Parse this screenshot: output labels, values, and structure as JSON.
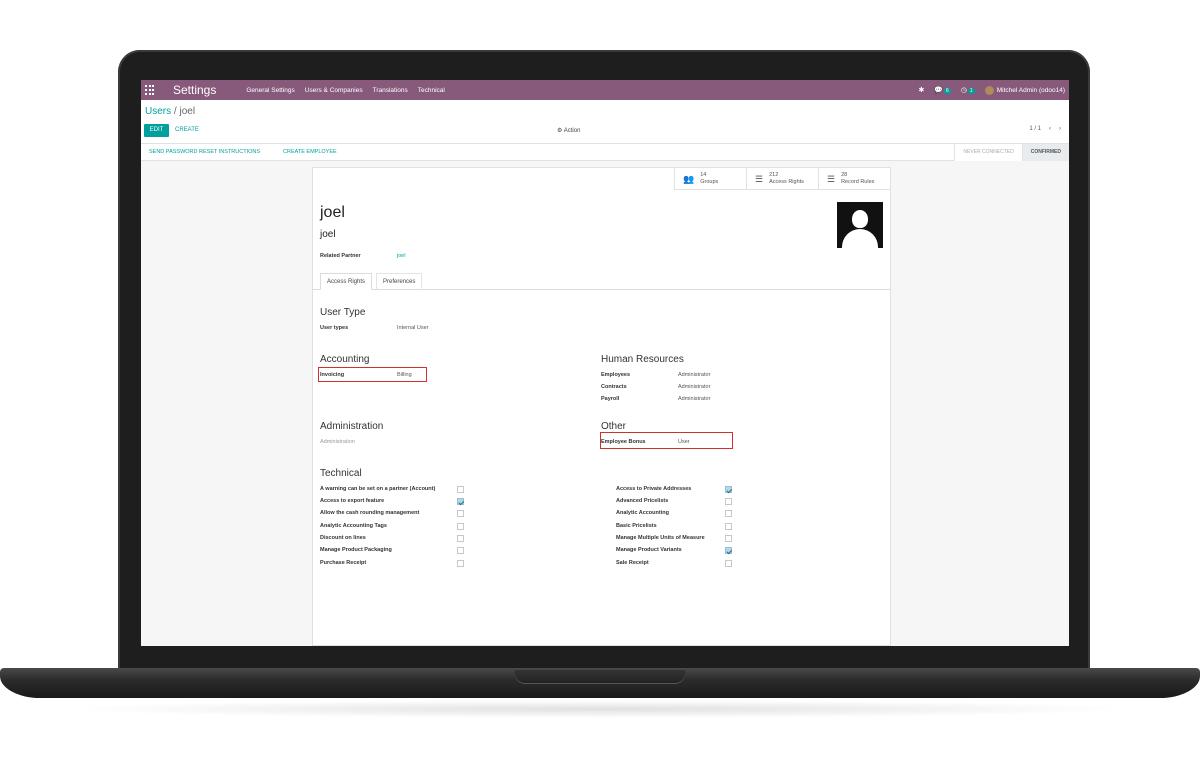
{
  "navbar": {
    "app_title": "Settings",
    "menu": [
      "General Settings",
      "Users & Companies",
      "Translations",
      "Technical"
    ],
    "messages_badge": "6",
    "activities_badge": "1",
    "user_name": "Mitchel Admin (odoo14)"
  },
  "control": {
    "breadcrumb_parent": "Users",
    "breadcrumb_separator": "/",
    "breadcrumb_current": "joel",
    "edit_label": "EDIT",
    "create_label": "CREATE",
    "action_label": "Action",
    "pager": "1 / 1",
    "prev": "‹",
    "next": "›"
  },
  "statusbar": {
    "send_reset": "SEND PASSWORD RESET INSTRUCTIONS",
    "create_employee": "CREATE EMPLOYEE",
    "stage_never": "NEVER CONNECTED",
    "stage_confirmed": "CONFIRMED"
  },
  "stats": {
    "groups_count": "14",
    "groups_label": "Groups",
    "access_count": "212",
    "access_label": "Access Rights",
    "rules_count": "28",
    "rules_label": "Record Rules"
  },
  "form": {
    "name": "joel",
    "login": "joel",
    "related_partner_label": "Related Partner",
    "related_partner_value": "joel",
    "tab_access": "Access Rights",
    "tab_prefs": "Preferences",
    "user_type_title": "User Type",
    "user_types_label": "User types",
    "user_types_value": "Internal User",
    "accounting_title": "Accounting",
    "invoicing_label": "Invoicing",
    "invoicing_value": "Billing",
    "hr_title": "Human Resources",
    "employees_label": "Employees",
    "employees_value": "Administrator",
    "contracts_label": "Contracts",
    "contracts_value": "Administrator",
    "payroll_label": "Payroll",
    "payroll_value": "Administrator",
    "administration_title": "Administration",
    "administration_value": "Administration",
    "other_title": "Other",
    "employee_bonus_label": "Employee Bonus",
    "employee_bonus_value": "User",
    "technical_title": "Technical"
  },
  "technical_left": [
    {
      "label": "A warning can be set on a partner (Account)",
      "checked": false
    },
    {
      "label": "Access to export feature",
      "checked": true
    },
    {
      "label": "Allow the cash rounding management",
      "checked": false
    },
    {
      "label": "Analytic Accounting Tags",
      "checked": false
    },
    {
      "label": "Discount on lines",
      "checked": false
    },
    {
      "label": "Manage Product Packaging",
      "checked": false
    },
    {
      "label": "Purchase Receipt",
      "checked": false
    }
  ],
  "technical_right": [
    {
      "label": "Access to Private Addresses",
      "checked": true
    },
    {
      "label": "Advanced Pricelists",
      "checked": false
    },
    {
      "label": "Analytic Accounting",
      "checked": false
    },
    {
      "label": "Basic Pricelists",
      "checked": false
    },
    {
      "label": "Manage Multiple Units of Measure",
      "checked": false
    },
    {
      "label": "Manage Product Variants",
      "checked": true
    },
    {
      "label": "Sale Receipt",
      "checked": false
    }
  ],
  "colors": {
    "navbar": "#875a7b",
    "accent": "#00a09d",
    "highlight": "#d0312d"
  }
}
